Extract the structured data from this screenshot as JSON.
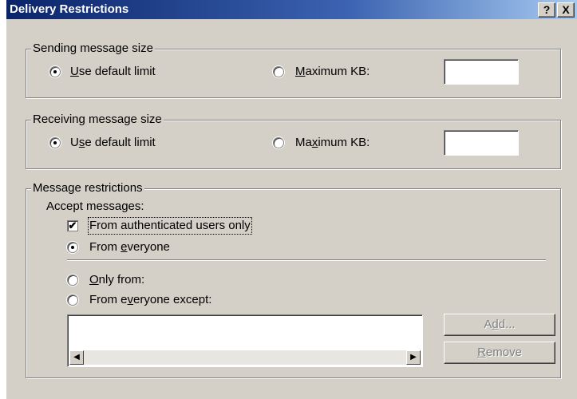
{
  "window": {
    "title": "Delivery Restrictions",
    "help_glyph": "?",
    "close_glyph": "X"
  },
  "sending": {
    "group_label": "Sending message size",
    "use_default_label": "Use default limit",
    "maximum_label": "Maximum KB:",
    "maximum_value": "",
    "selected": "use_default"
  },
  "receiving": {
    "group_label": "Receiving message size",
    "use_default_label": "Use default limit",
    "maximum_label": "Maximum KB:",
    "maximum_value": "",
    "selected": "use_default"
  },
  "restrictions": {
    "group_label": "Message restrictions",
    "accept_label": "Accept messages:",
    "authenticated_only_label": "From authenticated users only",
    "authenticated_only_checked": true,
    "from_everyone_label": "From everyone",
    "only_from_label": "Only from:",
    "everyone_except_label": "From everyone except:",
    "selected": "from_everyone",
    "list_items": [],
    "add_button": "Add...",
    "remove_button": "Remove"
  },
  "icons": {
    "scroll_left": "left-arrow-icon",
    "scroll_right": "right-arrow-icon"
  }
}
